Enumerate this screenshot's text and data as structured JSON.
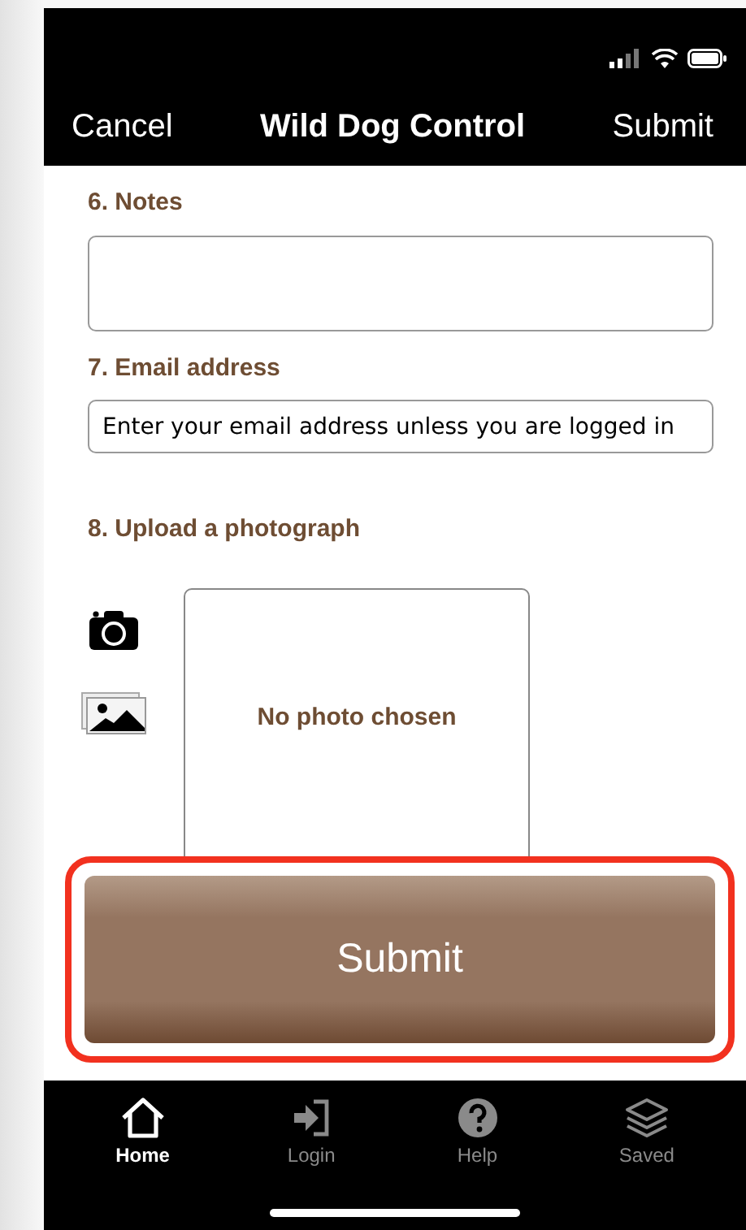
{
  "nav_bar": {
    "left_action": "Cancel",
    "title": "Wild Dog Control",
    "right_action": "Submit"
  },
  "form": {
    "notes": {
      "label": "6. Notes"
    },
    "email": {
      "label": "7. Email address",
      "placeholder": "Enter your email address unless you are logged in"
    },
    "photo": {
      "label": "8. Upload a photograph",
      "empty_text": "No photo chosen"
    }
  },
  "submit_button": {
    "label": "Submit",
    "highlighted": true
  },
  "tab_bar": [
    {
      "label": "Home",
      "selected": true
    },
    {
      "label": "Login",
      "selected": false
    },
    {
      "label": "Help",
      "selected": false
    },
    {
      "label": "Saved",
      "selected": false
    }
  ]
}
